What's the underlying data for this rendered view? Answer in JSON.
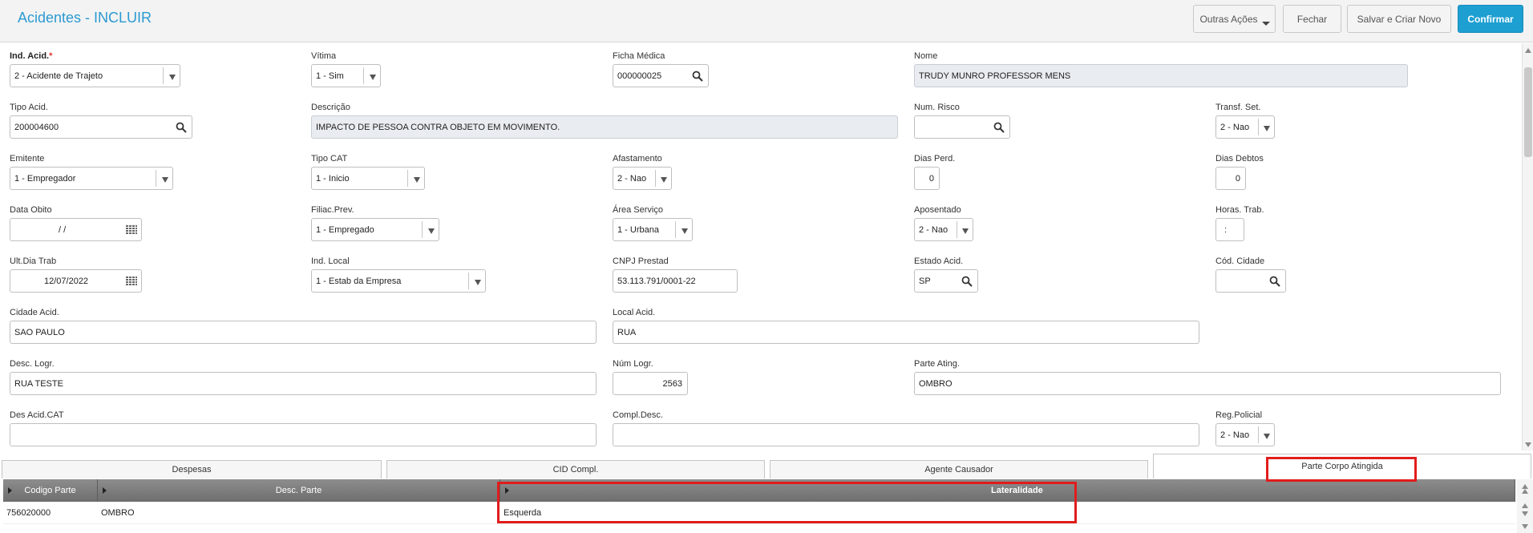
{
  "header": {
    "title": "Acidentes - INCLUIR",
    "buttons": {
      "outras_acoes": "Outras Ações",
      "fechar": "Fechar",
      "salvar_criar": "Salvar e Criar Novo",
      "confirmar": "Confirmar"
    }
  },
  "form": {
    "ind_acid": {
      "label": "Ind. Acid.",
      "required": "*",
      "value": "2 - Acidente de Trajeto"
    },
    "vitima": {
      "label": "Vítima",
      "value": "1 - Sim"
    },
    "ficha_medica": {
      "label": "Ficha Médica",
      "value": "000000025"
    },
    "nome": {
      "label": "Nome",
      "value": "TRUDY MUNRO PROFESSOR MENS"
    },
    "tipo_acid": {
      "label": "Tipo Acid.",
      "value": "200004600"
    },
    "descricao": {
      "label": "Descrição",
      "value": "IMPACTO DE PESSOA CONTRA OBJETO EM MOVIMENTO."
    },
    "num_risco": {
      "label": "Num. Risco",
      "value": ""
    },
    "transf_set": {
      "label": "Transf. Set.",
      "value": "2 - Nao"
    },
    "emitente": {
      "label": "Emitente",
      "value": "1 - Empregador"
    },
    "tipo_cat": {
      "label": "Tipo CAT",
      "value": "1 - Inicio"
    },
    "afastamento": {
      "label": "Afastamento",
      "value": "2 - Nao"
    },
    "dias_perd": {
      "label": "Dias Perd.",
      "value": "0"
    },
    "dias_debtos": {
      "label": "Dias Debtos",
      "value": "0"
    },
    "data_obito": {
      "label": "Data Obito",
      "value": "/ /"
    },
    "filiac_prev": {
      "label": "Filiac.Prev.",
      "value": "1 - Empregado"
    },
    "area_servico": {
      "label": "Área Serviço",
      "value": "1 - Urbana"
    },
    "aposentado": {
      "label": "Aposentado",
      "value": "2 - Nao"
    },
    "horas_trab": {
      "label": "Horas. Trab.",
      "value": ":"
    },
    "ult_dia_trab": {
      "label": "Ult.Dia Trab",
      "value": "12/07/2022"
    },
    "ind_local": {
      "label": "Ind. Local",
      "value": "1 - Estab da Empresa"
    },
    "cnpj_prestad": {
      "label": "CNPJ Prestad",
      "value": "53.113.791/0001-22"
    },
    "estado_acid": {
      "label": "Estado Acid.",
      "value": "SP"
    },
    "cod_cidade": {
      "label": "Cód. Cidade",
      "value": ""
    },
    "cidade_acid": {
      "label": "Cidade Acid.",
      "value": "SAO PAULO"
    },
    "local_acid": {
      "label": "Local Acid.",
      "value": "RUA"
    },
    "desc_logr": {
      "label": "Desc. Logr.",
      "value": "RUA TESTE"
    },
    "num_logr": {
      "label": "Núm Logr.",
      "value": "2563"
    },
    "parte_ating": {
      "label": "Parte Ating.",
      "value": "OMBRO"
    },
    "des_acid_cat": {
      "label": "Des Acid.CAT",
      "value": ""
    },
    "compl_desc": {
      "label": "Compl.Desc.",
      "value": ""
    },
    "reg_policial": {
      "label": "Reg.Policial",
      "value": "2 - Nao"
    }
  },
  "tabs": [
    "Despesas",
    "CID Compl.",
    "Agente Causador",
    "Parte Corpo Atingida"
  ],
  "active_tab": "Parte Corpo Atingida",
  "grid": {
    "columns": [
      "Codigo Parte",
      "Desc. Parte",
      "Lateralidade"
    ],
    "rows": [
      {
        "codigo": "756020000",
        "desc": "OMBRO",
        "lateralidade": "Esquerda"
      }
    ]
  },
  "colors": {
    "accent": "#2b9ad2",
    "primary_button": "#1d9fd2",
    "highlight": "#e11c1c"
  }
}
